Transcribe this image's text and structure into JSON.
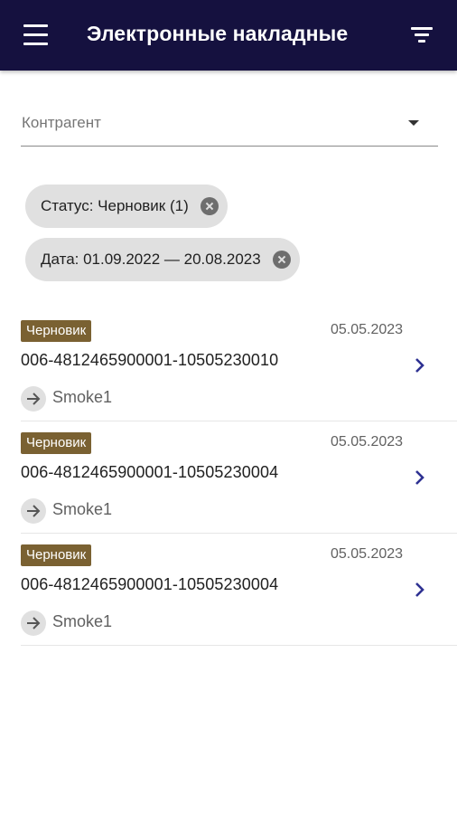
{
  "app_bar": {
    "title": "Электронные накладные",
    "menu_icon": "hamburger-menu-icon",
    "filter_icon": "filter-icon",
    "background": "#15113f"
  },
  "filters": {
    "contractor_label": "Контрагент",
    "chips": [
      {
        "label": "Статус: Черновик (1)"
      },
      {
        "label": "Дата: 01.09.2022 — 20.08.2023"
      }
    ]
  },
  "invoices": [
    {
      "status": "Черновик",
      "date": "05.05.2023",
      "number": "006-4812465900001-10505230010",
      "counterparty": "Smoke1"
    },
    {
      "status": "Черновик",
      "date": "05.05.2023",
      "number": "006-4812465900001-10505230004",
      "counterparty": "Smoke1"
    },
    {
      "status": "Черновик",
      "date": "05.05.2023",
      "number": "006-4812465900001-10505230004",
      "counterparty": "Smoke1"
    }
  ],
  "colors": {
    "status_badge": "#7a6132",
    "chevron": "#2e3192"
  }
}
